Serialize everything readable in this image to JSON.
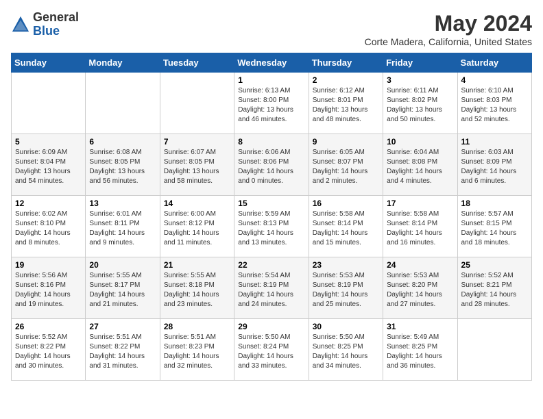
{
  "logo": {
    "general": "General",
    "blue": "Blue"
  },
  "title": "May 2024",
  "subtitle": "Corte Madera, California, United States",
  "days_of_week": [
    "Sunday",
    "Monday",
    "Tuesday",
    "Wednesday",
    "Thursday",
    "Friday",
    "Saturday"
  ],
  "weeks": [
    [
      {
        "day": "",
        "info": ""
      },
      {
        "day": "",
        "info": ""
      },
      {
        "day": "",
        "info": ""
      },
      {
        "day": "1",
        "info": "Sunrise: 6:13 AM\nSunset: 8:00 PM\nDaylight: 13 hours\nand 46 minutes."
      },
      {
        "day": "2",
        "info": "Sunrise: 6:12 AM\nSunset: 8:01 PM\nDaylight: 13 hours\nand 48 minutes."
      },
      {
        "day": "3",
        "info": "Sunrise: 6:11 AM\nSunset: 8:02 PM\nDaylight: 13 hours\nand 50 minutes."
      },
      {
        "day": "4",
        "info": "Sunrise: 6:10 AM\nSunset: 8:03 PM\nDaylight: 13 hours\nand 52 minutes."
      }
    ],
    [
      {
        "day": "5",
        "info": "Sunrise: 6:09 AM\nSunset: 8:04 PM\nDaylight: 13 hours\nand 54 minutes."
      },
      {
        "day": "6",
        "info": "Sunrise: 6:08 AM\nSunset: 8:05 PM\nDaylight: 13 hours\nand 56 minutes."
      },
      {
        "day": "7",
        "info": "Sunrise: 6:07 AM\nSunset: 8:05 PM\nDaylight: 13 hours\nand 58 minutes."
      },
      {
        "day": "8",
        "info": "Sunrise: 6:06 AM\nSunset: 8:06 PM\nDaylight: 14 hours\nand 0 minutes."
      },
      {
        "day": "9",
        "info": "Sunrise: 6:05 AM\nSunset: 8:07 PM\nDaylight: 14 hours\nand 2 minutes."
      },
      {
        "day": "10",
        "info": "Sunrise: 6:04 AM\nSunset: 8:08 PM\nDaylight: 14 hours\nand 4 minutes."
      },
      {
        "day": "11",
        "info": "Sunrise: 6:03 AM\nSunset: 8:09 PM\nDaylight: 14 hours\nand 6 minutes."
      }
    ],
    [
      {
        "day": "12",
        "info": "Sunrise: 6:02 AM\nSunset: 8:10 PM\nDaylight: 14 hours\nand 8 minutes."
      },
      {
        "day": "13",
        "info": "Sunrise: 6:01 AM\nSunset: 8:11 PM\nDaylight: 14 hours\nand 9 minutes."
      },
      {
        "day": "14",
        "info": "Sunrise: 6:00 AM\nSunset: 8:12 PM\nDaylight: 14 hours\nand 11 minutes."
      },
      {
        "day": "15",
        "info": "Sunrise: 5:59 AM\nSunset: 8:13 PM\nDaylight: 14 hours\nand 13 minutes."
      },
      {
        "day": "16",
        "info": "Sunrise: 5:58 AM\nSunset: 8:14 PM\nDaylight: 14 hours\nand 15 minutes."
      },
      {
        "day": "17",
        "info": "Sunrise: 5:58 AM\nSunset: 8:14 PM\nDaylight: 14 hours\nand 16 minutes."
      },
      {
        "day": "18",
        "info": "Sunrise: 5:57 AM\nSunset: 8:15 PM\nDaylight: 14 hours\nand 18 minutes."
      }
    ],
    [
      {
        "day": "19",
        "info": "Sunrise: 5:56 AM\nSunset: 8:16 PM\nDaylight: 14 hours\nand 19 minutes."
      },
      {
        "day": "20",
        "info": "Sunrise: 5:55 AM\nSunset: 8:17 PM\nDaylight: 14 hours\nand 21 minutes."
      },
      {
        "day": "21",
        "info": "Sunrise: 5:55 AM\nSunset: 8:18 PM\nDaylight: 14 hours\nand 23 minutes."
      },
      {
        "day": "22",
        "info": "Sunrise: 5:54 AM\nSunset: 8:19 PM\nDaylight: 14 hours\nand 24 minutes."
      },
      {
        "day": "23",
        "info": "Sunrise: 5:53 AM\nSunset: 8:19 PM\nDaylight: 14 hours\nand 25 minutes."
      },
      {
        "day": "24",
        "info": "Sunrise: 5:53 AM\nSunset: 8:20 PM\nDaylight: 14 hours\nand 27 minutes."
      },
      {
        "day": "25",
        "info": "Sunrise: 5:52 AM\nSunset: 8:21 PM\nDaylight: 14 hours\nand 28 minutes."
      }
    ],
    [
      {
        "day": "26",
        "info": "Sunrise: 5:52 AM\nSunset: 8:22 PM\nDaylight: 14 hours\nand 30 minutes."
      },
      {
        "day": "27",
        "info": "Sunrise: 5:51 AM\nSunset: 8:22 PM\nDaylight: 14 hours\nand 31 minutes."
      },
      {
        "day": "28",
        "info": "Sunrise: 5:51 AM\nSunset: 8:23 PM\nDaylight: 14 hours\nand 32 minutes."
      },
      {
        "day": "29",
        "info": "Sunrise: 5:50 AM\nSunset: 8:24 PM\nDaylight: 14 hours\nand 33 minutes."
      },
      {
        "day": "30",
        "info": "Sunrise: 5:50 AM\nSunset: 8:25 PM\nDaylight: 14 hours\nand 34 minutes."
      },
      {
        "day": "31",
        "info": "Sunrise: 5:49 AM\nSunset: 8:25 PM\nDaylight: 14 hours\nand 36 minutes."
      },
      {
        "day": "",
        "info": ""
      }
    ]
  ]
}
